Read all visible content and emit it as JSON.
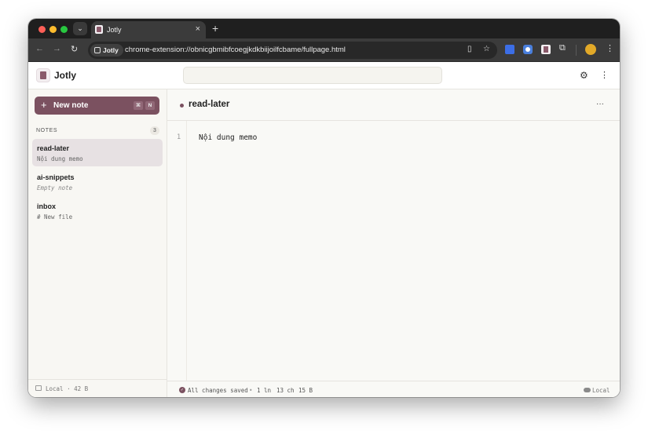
{
  "browser": {
    "tab_title": "Jotly",
    "chip_label": "Jotly",
    "url": "chrome-extension://obnicgbmibfcoegjkdkbiijoilfcbame/fullpage.html"
  },
  "app": {
    "title": "Jotly",
    "search_value": "",
    "new_note_label": "New note",
    "new_note_shortcut": [
      "⌘",
      "N"
    ]
  },
  "sidebar": {
    "notes_heading": "NOTES",
    "notes_count": "3",
    "notes": [
      {
        "title": "read-later",
        "preview": "Nội dung memo",
        "active": true
      },
      {
        "title": "ai-snippets",
        "preview": "Empty note",
        "active": false
      },
      {
        "title": "inbox",
        "preview": "# New file",
        "active": false
      }
    ],
    "footer": "Local · 42 B"
  },
  "editor": {
    "note_name": "read-later",
    "line_numbers": [
      "1"
    ],
    "lines": [
      "Nội dung memo"
    ]
  },
  "status": {
    "saved": "All changes saved",
    "separator": "•",
    "lines": "1 ln",
    "chars": "13 ch",
    "bytes": "15 B",
    "storage": "Local"
  },
  "colors": {
    "accent": "#7b5160",
    "active_note_bg": "#e7e1e3",
    "editor_bg": "#f9f9f6"
  },
  "icons": {
    "settings": "gear-icon",
    "more": "more-vertical-icon",
    "editor_more": "more-horizontal-icon"
  }
}
